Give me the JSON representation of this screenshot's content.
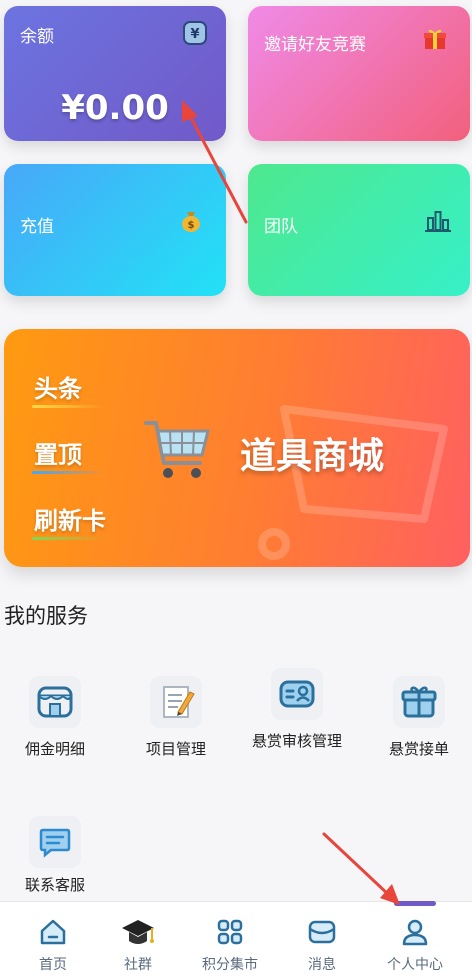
{
  "cards": {
    "balance": {
      "label": "余额",
      "amount": "¥0.00",
      "icon": "yuan-badge-icon"
    },
    "invite": {
      "label": "邀请好友竞赛",
      "icon": "gift-icon"
    },
    "recharge": {
      "label": "充值",
      "icon": "money-bag-icon"
    },
    "team": {
      "label": "团队",
      "icon": "bar-chart-icon"
    }
  },
  "store": {
    "items": [
      "头条",
      "置顶",
      "刷新卡"
    ],
    "title": "道具商城",
    "icon": "shopping-cart-icon"
  },
  "services": {
    "title": "我的服务",
    "items": [
      {
        "label": "佣金明细",
        "icon": "store-icon"
      },
      {
        "label": "项目管理",
        "icon": "memo-icon"
      },
      {
        "label": "悬赏审核管理",
        "icon": "id-card-icon"
      },
      {
        "label": "悬赏接单",
        "icon": "gift-box-icon"
      },
      {
        "label": "联系客服",
        "icon": "chat-icon"
      }
    ]
  },
  "nav": {
    "items": [
      {
        "label": "首页",
        "icon": "home-icon"
      },
      {
        "label": "社群",
        "icon": "graduation-cap-icon"
      },
      {
        "label": "积分集市",
        "icon": "grid-icon"
      },
      {
        "label": "消息",
        "icon": "message-icon"
      },
      {
        "label": "个人中心",
        "icon": "user-icon"
      }
    ],
    "active": "个人中心"
  },
  "colors": {
    "balance_gradient": [
      "#6c74e0",
      "#7159c8"
    ],
    "invite_gradient": [
      "#f08ae8",
      "#f2607c"
    ],
    "recharge_gradient": [
      "#48a8f8",
      "#22e2f6"
    ],
    "team_gradient": [
      "#4ee88e",
      "#36f0c8"
    ],
    "store_gradient": [
      "#ff9a10",
      "#ff6060"
    ],
    "icon_blue": "#2b6f9c",
    "annotation_arrow": "#e8453c"
  }
}
